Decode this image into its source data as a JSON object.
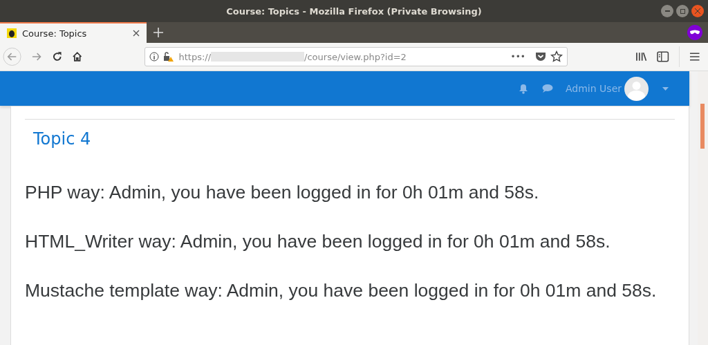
{
  "window": {
    "title": "Course: Topics - Mozilla Firefox (Private Browsing)"
  },
  "tabs": [
    {
      "label": "Course: Topics",
      "selected": true
    }
  ],
  "address_bar": {
    "scheme": "https://",
    "path": "/course/view.php?id=2",
    "more": "•••"
  },
  "navbar": {
    "user": "Admin User"
  },
  "section": {
    "title": "Topic 4"
  },
  "paragraphs": [
    "PHP way: Admin, you have been logged in for 0h 01m and 58s.",
    "HTML_Writer way: Admin, you have been logged in for 0h 01m and 58s.",
    "Mustache template way: Admin, you have been logged in for 0h 01m and 58s."
  ]
}
